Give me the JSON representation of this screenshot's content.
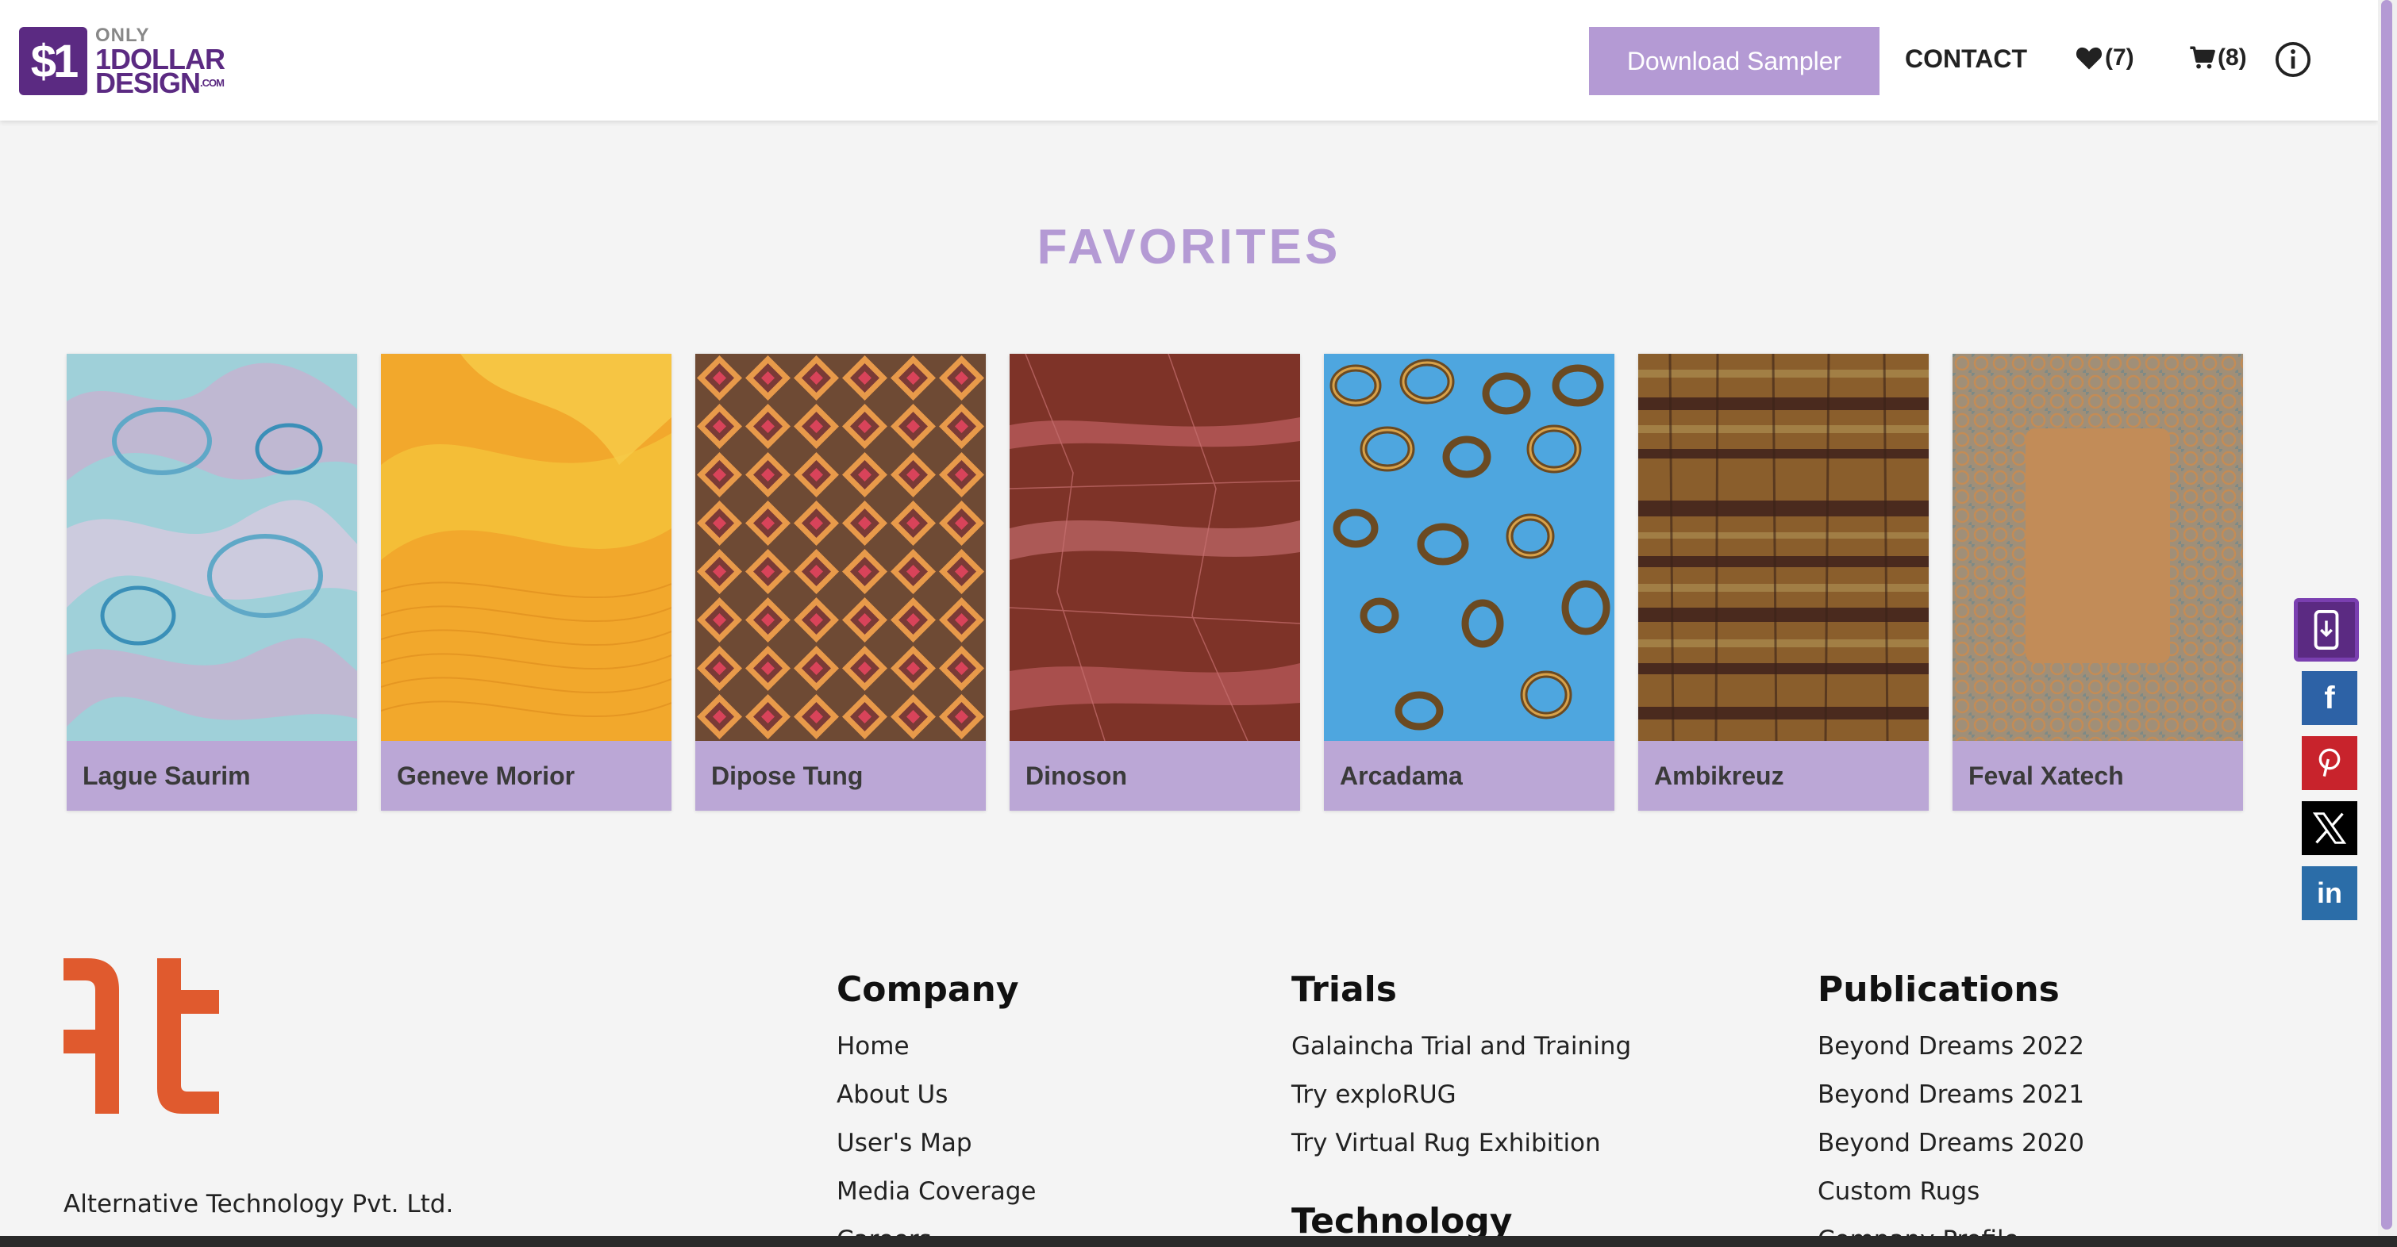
{
  "header": {
    "logo": {
      "only": "ONLY",
      "line2": "1DOLLAR",
      "line3": "DESIGN",
      "com": ".COM",
      "mark": "$1"
    },
    "download_sampler": "Download Sampler",
    "contact": "CONTACT",
    "favorites_count": "(7)",
    "cart_count": "(8)",
    "icons": {
      "favorites": "heart-icon",
      "cart": "cart-icon",
      "info": "info-icon"
    }
  },
  "favorites": {
    "title": "FAVORITES",
    "cards": [
      {
        "name": "Lague Saurim"
      },
      {
        "name": "Geneve Morior"
      },
      {
        "name": "Dipose Tung"
      },
      {
        "name": "Dinoson"
      },
      {
        "name": "Arcadama"
      },
      {
        "name": "Ambikreuz"
      },
      {
        "name": "Feval Xatech"
      }
    ]
  },
  "social": {
    "items": [
      "app-download-icon",
      "facebook-icon",
      "pinterest-icon",
      "x-icon",
      "linkedin-icon"
    ],
    "colors": {
      "facebook": "#2d62a6",
      "pinterest": "#c8232c",
      "x": "#000000",
      "linkedin": "#2b6da8"
    }
  },
  "footer": {
    "company_name": "Alternative Technology Pvt. Ltd.",
    "company": {
      "title": "Company",
      "links": [
        "Home",
        "About Us",
        "User's Map",
        "Media Coverage",
        "Careers"
      ]
    },
    "trials": {
      "title": "Trials",
      "links": [
        "Galaincha Trial and Training",
        "Try exploRUG",
        "Try Virtual Rug Exhibition"
      ]
    },
    "technology": {
      "title": "Technology"
    },
    "publications": {
      "title": "Publications",
      "links": [
        "Beyond Dreams 2022",
        "Beyond Dreams 2021",
        "Beyond Dreams 2020",
        "Custom Rugs",
        "Company Profile"
      ]
    }
  },
  "colors": {
    "accent": "#b49ad4",
    "card_label_bg": "#bba7d6",
    "brand": "#5b2a82",
    "at_logo": "#e05a2e"
  }
}
